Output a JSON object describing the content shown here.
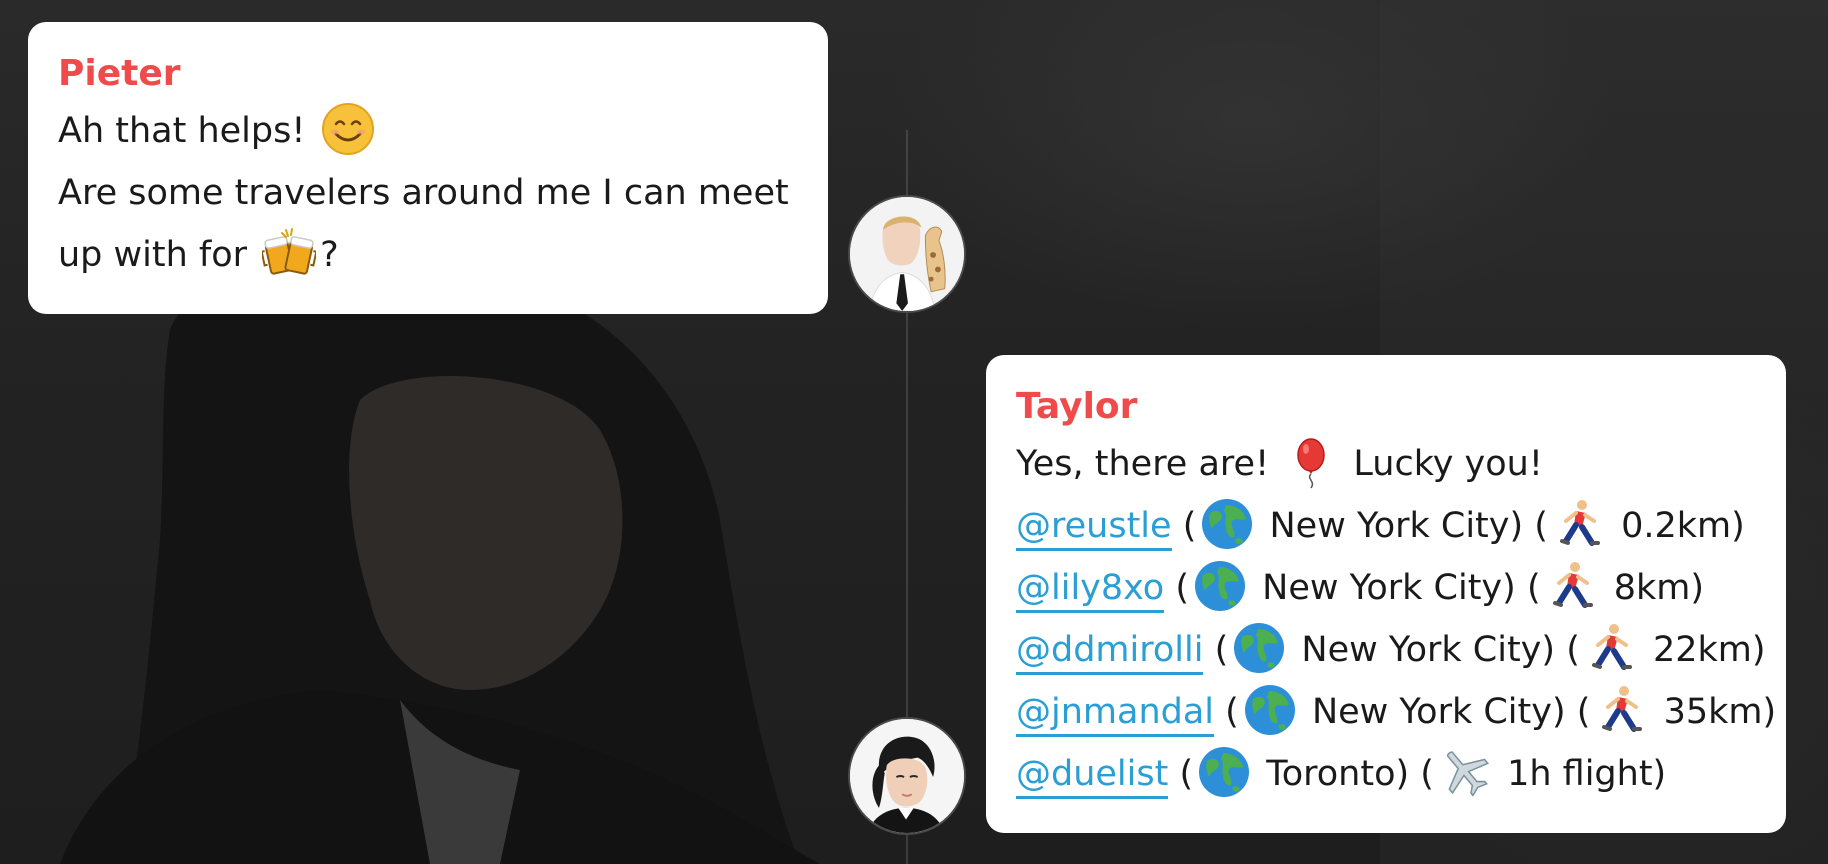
{
  "messages": [
    {
      "sender": "Pieter",
      "lines": {
        "line1_text": "Ah that helps!",
        "line1_emoji": "smiling-face-emoji",
        "line2_text": "Are some travelers around me I can meet",
        "line3_text": "up with for",
        "line3_emoji": "beer-mugs-emoji",
        "line3_suffix": "?"
      }
    },
    {
      "sender": "Taylor",
      "intro": {
        "text_before": "Yes, there are!",
        "emoji": "balloon-emoji",
        "text_after": "Lucky you!"
      },
      "travelers": [
        {
          "handle": "@reustle",
          "open": "(",
          "globe": "globe-emoji",
          "city": "New York City)",
          "open2": "(",
          "mode": "runner-emoji",
          "distance": "0.2km)"
        },
        {
          "handle": "@lily8xo",
          "open": "(",
          "globe": "globe-emoji",
          "city": "New York City)",
          "open2": "(",
          "mode": "runner-emoji",
          "distance": "8km)"
        },
        {
          "handle": "@ddmirolli",
          "open": "(",
          "globe": "globe-emoji",
          "city": "New York City)",
          "open2": "(",
          "mode": "runner-emoji",
          "distance": "22km)"
        },
        {
          "handle": "@jnmandal",
          "open": "(",
          "globe": "globe-emoji",
          "city": "New York City)",
          "open2": "(",
          "mode": "runner-emoji",
          "distance": "35km)"
        },
        {
          "handle": "@duelist",
          "open": "(",
          "globe": "globe-emoji",
          "city": "Toronto)",
          "open2": "(",
          "mode": "airplane-emoji",
          "distance": "1h flight)"
        }
      ]
    }
  ],
  "colors": {
    "sender_name": "#ef4b4b",
    "mention": "#2a9fd6",
    "bubble_bg": "#ffffff",
    "background": "#1c1c1c"
  }
}
